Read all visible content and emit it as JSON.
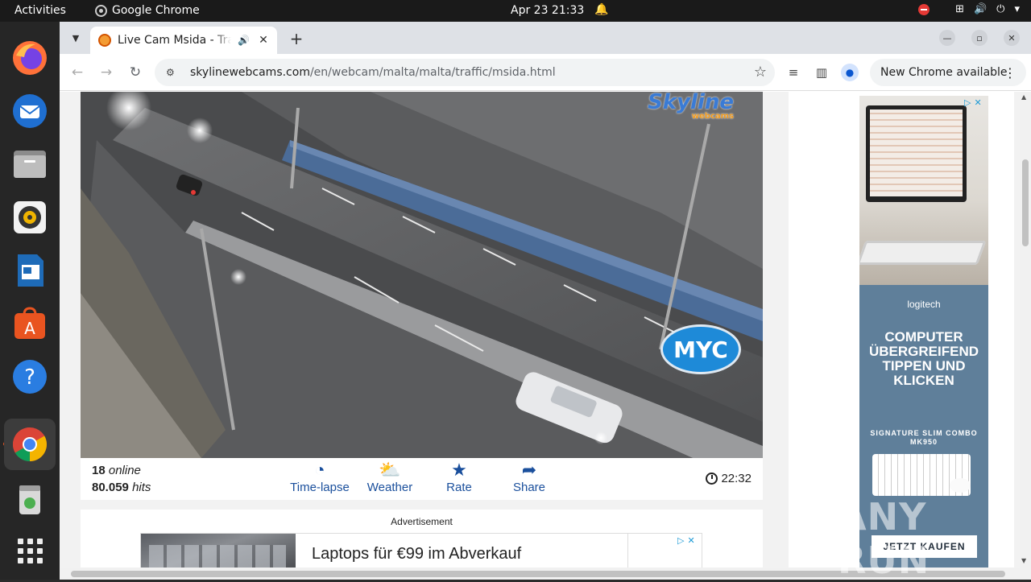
{
  "topbar": {
    "activities": "Activities",
    "app_name": "Google Chrome",
    "clock": "Apr 23  21:33"
  },
  "dock": {
    "items": [
      {
        "name": "Firefox"
      },
      {
        "name": "Thunderbird"
      },
      {
        "name": "Files"
      },
      {
        "name": "Rhythmbox"
      },
      {
        "name": "LibreOffice Writer"
      },
      {
        "name": "Ubuntu Software"
      },
      {
        "name": "Help"
      },
      {
        "name": "Google Chrome"
      },
      {
        "name": "Trash"
      },
      {
        "name": "Show Applications"
      }
    ]
  },
  "browser": {
    "tab_title": "Live Cam Msida - Traffic",
    "url_host": "skylinewebcams.com",
    "url_path": "/en/webcam/malta/malta/traffic/msida.html",
    "update_label": "New Chrome available"
  },
  "webcam": {
    "watermark": "Skyline",
    "watermark_sub": "webcams",
    "badge": "MYC"
  },
  "info": {
    "online_count": "18",
    "online_label": "online",
    "hits_count": "80.059",
    "hits_label": "hits",
    "actions": [
      {
        "label": "Time-lapse"
      },
      {
        "label": "Weather"
      },
      {
        "label": "Rate"
      },
      {
        "label": "Share"
      }
    ],
    "time": "22:32"
  },
  "ad_bottom": {
    "label": "Advertisement",
    "text": "Laptops für €99 im Abverkauf"
  },
  "ad_side": {
    "brand": "logitech",
    "headline": "COMPUTER ÜBERGREIFEND TIPPEN UND KLICKEN",
    "subline": "SIGNATURE SLIM COMBO MK950",
    "cta": "JETZT KAUFEN"
  },
  "watermark": "ANY RUN",
  "colors": {
    "accent_blue": "#1a4f9c",
    "topbar": "#1a1a1a",
    "dock": "#262626",
    "tabstrip": "#dee1e6"
  }
}
